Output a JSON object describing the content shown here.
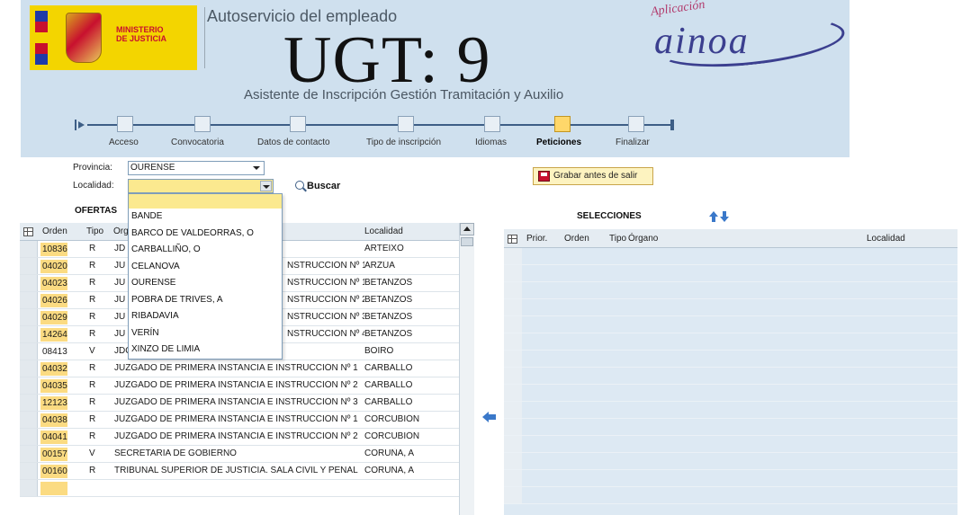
{
  "header": {
    "ministry": "MINISTERIO\nDE JUSTICIA",
    "app_title": "Autoservicio del empleado",
    "overlay": "UGT: 9",
    "subtitle": "Asistente de Inscripción Gestión Tramitación y Auxilio",
    "brand_small": "Aplicación",
    "brand": "ainoa"
  },
  "steps": [
    {
      "label": "Acceso",
      "active": false
    },
    {
      "label": "Convocatoria",
      "active": false
    },
    {
      "label": "Datos de contacto",
      "active": false
    },
    {
      "label": "Tipo de inscripción",
      "active": false
    },
    {
      "label": "Idiomas",
      "active": false
    },
    {
      "label": "Peticiones",
      "active": true
    },
    {
      "label": "Finalizar",
      "active": false
    }
  ],
  "filters": {
    "provincia_label": "Provincia:",
    "provincia_value": "OURENSE",
    "localidad_label": "Localidad:",
    "localidad_value": "",
    "buscar": "Buscar"
  },
  "save_button": "Grabar antes de salir",
  "localidad_options": [
    "BANDE",
    "BARCO DE VALDEORRAS, O",
    "CARBALLIÑO, O",
    "CELANOVA",
    "OURENSE",
    "POBRA DE TRIVES, A",
    "RIBADAVIA",
    "VERÍN",
    "XINZO DE LIMIA"
  ],
  "ofertas": {
    "title": "OFERTAS",
    "columns": {
      "orden": "Orden",
      "tipo": "Tipo",
      "organo": "Órgano",
      "localidad": "Localidad"
    },
    "rows": [
      {
        "orden": "10836",
        "tipo": "R",
        "organo": "JD",
        "localidad": "ARTEIXO"
      },
      {
        "orden": "04020",
        "tipo": "R",
        "organo": "JU",
        "localidad": "ARZÚA"
      },
      {
        "orden": "04023",
        "tipo": "R",
        "organo": "JU",
        "localidad": "BETANZOS"
      },
      {
        "orden": "04026",
        "tipo": "R",
        "organo": "JU",
        "localidad": "BETANZOS"
      },
      {
        "orden": "04029",
        "tipo": "R",
        "organo": "JU",
        "localidad": "BETANZOS"
      },
      {
        "orden": "14264",
        "tipo": "R",
        "organo": "JU",
        "localidad": "BETANZOS"
      },
      {
        "orden": "08413",
        "tipo": "V",
        "organo": "JDO. DE PAZ DE BOIRO",
        "localidad": "BOIRO"
      },
      {
        "orden": "04032",
        "tipo": "R",
        "organo": "JUZGADO DE PRIMERA INSTANCIA E INSTRUCCIÓN Nº 1",
        "localidad": "CARBALLO"
      },
      {
        "orden": "04035",
        "tipo": "R",
        "organo": "JUZGADO DE PRIMERA INSTANCIA E INSTRUCCIÓN Nº 2",
        "localidad": "CARBALLO"
      },
      {
        "orden": "12123",
        "tipo": "R",
        "organo": "JUZGADO DE PRIMERA INSTANCIA E INSTRUCCIÓN Nº 3",
        "localidad": "CARBALLO"
      },
      {
        "orden": "04038",
        "tipo": "R",
        "organo": "JUZGADO DE PRIMERA INSTANCIA E INSTRUCCIÓN Nº 1",
        "localidad": "CORCUBIÓN"
      },
      {
        "orden": "04041",
        "tipo": "R",
        "organo": "JUZGADO DE PRIMERA INSTANCIA E INSTRUCCIÓN Nº 2",
        "localidad": "CORCUBIÓN"
      },
      {
        "orden": "00157",
        "tipo": "V",
        "organo": "SECRETARIA DE GOBIERNO",
        "localidad": "CORUÑA, A"
      },
      {
        "orden": "00160",
        "tipo": "R",
        "organo": "TRIBUNAL SUPERIOR DE JUSTICIA. SALA CIVIL Y PENAL",
        "localidad": "CORUÑA, A"
      }
    ],
    "hidden_overlap_text": [
      "",
      "NSTRUCCIÓN Nº 1",
      "NSTRUCCIÓN Nº 1",
      "NSTRUCCIÓN Nº 2",
      "NSTRUCCIÓN Nº 3",
      "NSTRUCCIÓN Nº 4"
    ]
  },
  "selecciones": {
    "title": "SELECCIONES",
    "columns": {
      "prior": "Prior.",
      "orden": "Orden",
      "tipo": "Tipo",
      "organo": "Órgano",
      "localidad": "Localidad"
    }
  },
  "colors": {
    "header_bg": "#cfe0ee",
    "highlight": "#fbdb82",
    "accent_blue": "#3a78c9",
    "brand": "#3b3f8f"
  }
}
